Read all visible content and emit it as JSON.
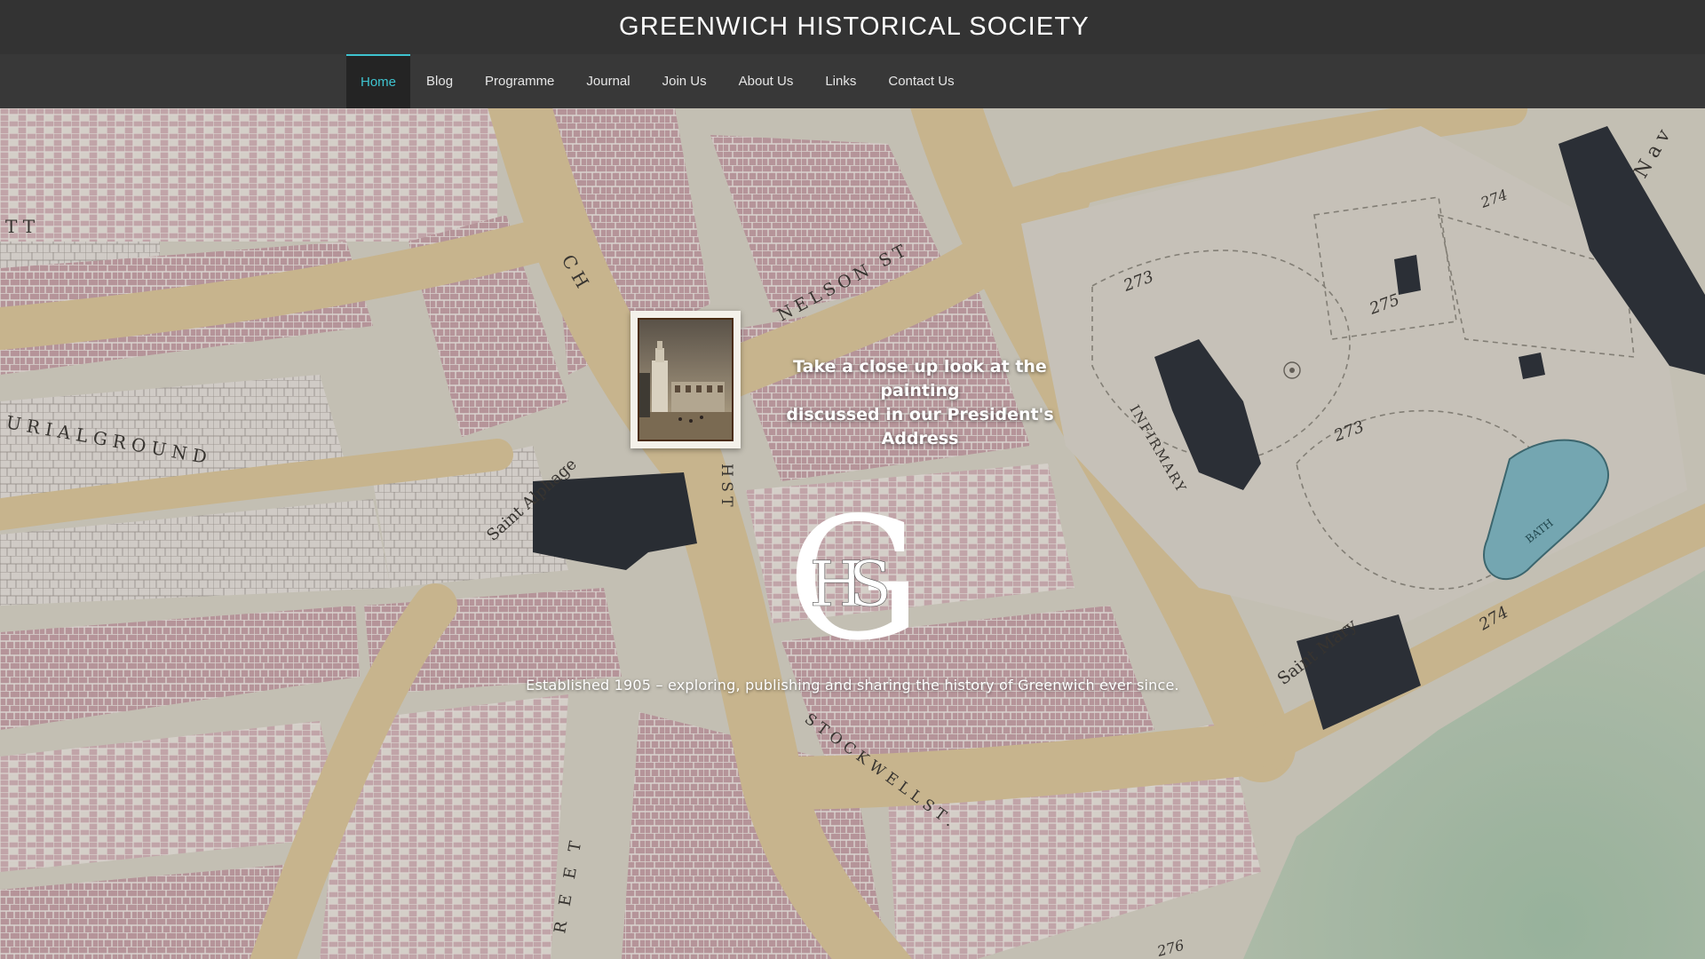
{
  "site": {
    "title": "GREENWICH HISTORICAL SOCIETY"
  },
  "nav": {
    "items": [
      {
        "label": "Home",
        "active": true
      },
      {
        "label": "Blog"
      },
      {
        "label": "Programme"
      },
      {
        "label": "Journal"
      },
      {
        "label": "Join Us"
      },
      {
        "label": "About Us"
      },
      {
        "label": "Links"
      },
      {
        "label": "Contact Us"
      }
    ]
  },
  "hero": {
    "caption_line1": "Take a close up look at the painting",
    "caption_line2": "discussed in our President's Address",
    "tagline": "Established 1905 – exploring, publishing and sharing the history of Greenwich ever since.",
    "logo_letters": {
      "g": "G",
      "h": "H",
      "s": "S"
    },
    "map_labels": {
      "street_ch": "C H",
      "nelson": "NELSON ST",
      "burial_ground": "U R I A L   G R O U N D",
      "saint_alphage": "Saint Alphage",
      "infirmary": "INFIRMARY",
      "saint_mary": "Saint Mary",
      "stockwell": "S T O C K W E L L   S T .",
      "street_e": "R E E T",
      "bath": "BATH",
      "n_st": "H  S T",
      "tt": "T T",
      "nav": "N a v",
      "num_273a": "273",
      "num_273b": "273",
      "num_275": "275",
      "num_274a": "274",
      "num_274b": "274",
      "num_276": "276"
    }
  },
  "colors": {
    "accent": "#3ec3cf",
    "header_bg": "#333333",
    "nav_bg": "#383838",
    "nav_active_bg": "#242424"
  }
}
